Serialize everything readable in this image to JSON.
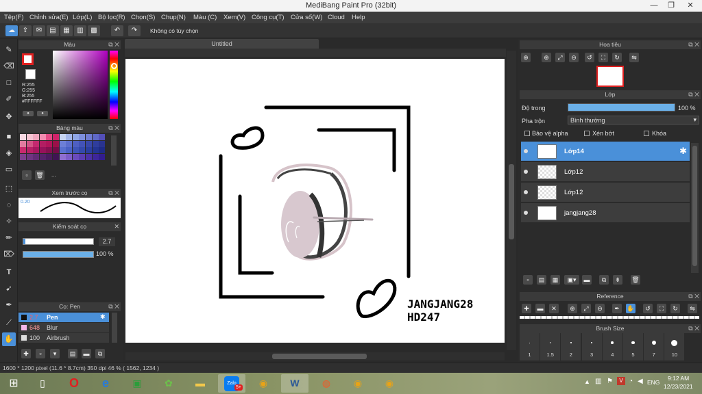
{
  "window": {
    "title": "MediBang Paint Pro (32bit)",
    "minimize": "—",
    "restore": "❐",
    "close": "✕"
  },
  "menu": [
    "Tệp(F)",
    "Chỉnh sửa(E)",
    "Lớp(L)",
    "Bộ lọc(R)",
    "Chọn(S)",
    "Chụp(N)",
    "Màu (C)",
    "Xem(V)",
    "Công cụ(T)",
    "Cửa sổ(W)",
    "Cloud",
    "Help"
  ],
  "toolbar": {
    "option_text": "Không có tùy chọn"
  },
  "color_panel": {
    "title": "Màu",
    "r": "R:255",
    "g": "G:255",
    "b": "B:255",
    "hex": "#FFFFFF",
    "primary_color": "#e02020",
    "secondary_color": "#ffffff"
  },
  "palette_panel": {
    "title": "Bảng màu",
    "more": "..."
  },
  "brush_preview": {
    "title": "Xem trước cọ",
    "size": "0.20"
  },
  "brush_control": {
    "title": "Kiểm soát cọ",
    "size_value": "2.7",
    "opacity_value": "100 %"
  },
  "brush_list": {
    "title": "Cọ: Pen",
    "items": [
      {
        "size": "2.7",
        "name": "Pen",
        "selected": true
      },
      {
        "size": "648",
        "name": "Blur",
        "selected": false
      },
      {
        "size": "100",
        "name": "Airbrush",
        "selected": false
      }
    ]
  },
  "document": {
    "tab": "Untitled"
  },
  "artwork": {
    "line1": "JANGJANG28",
    "line2": "HD247"
  },
  "navigator": {
    "title": "Hoa tiêu"
  },
  "layers": {
    "title": "Lớp",
    "opacity_label": "Độ trong",
    "opacity_value": "100 %",
    "opacity_fraction": 1.0,
    "blend_label": "Pha trộn",
    "blend_value": "Bình thường",
    "protect_alpha": "Bảo vệ alpha",
    "clipping": "Xén bớt",
    "lock": "Khóa",
    "items": [
      {
        "name": "Lớp14",
        "selected": true
      },
      {
        "name": "Lớp12",
        "selected": false
      },
      {
        "name": "Lớp12",
        "selected": false
      },
      {
        "name": "jangjang28",
        "selected": false
      }
    ]
  },
  "reference": {
    "title": "Reference"
  },
  "brush_size": {
    "title": "Brush Size",
    "sizes": [
      "1",
      "1.5",
      "2",
      "3",
      "4",
      "5",
      "7",
      "10"
    ]
  },
  "status": {
    "text": "1600 * 1200 pixel   (11.6 * 8.7cm)   350 dpi   46 %   ( 1562, 1234 )"
  },
  "taskbar": {
    "lang": "ENG",
    "time": "9:12 AM",
    "date": "12/23/2021",
    "zalo_badge": "5+"
  }
}
